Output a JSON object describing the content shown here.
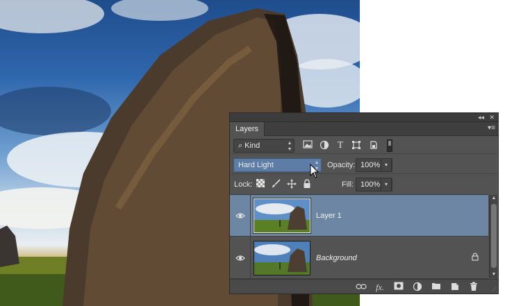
{
  "panel": {
    "tab_label": "Layers",
    "collapse_glyph": "◂◂",
    "close_glyph": "✕",
    "menu_glyph": "▾≡"
  },
  "filter": {
    "kind_label": "Kind",
    "kind_glyph": "⌕",
    "type_filter_glyph": "T"
  },
  "blend": {
    "mode": "Hard Light",
    "opacity_label": "Opacity:",
    "opacity_value": "100%",
    "fill_label": "Fill:",
    "fill_value": "100%"
  },
  "lock": {
    "label": "Lock:"
  },
  "layers": [
    {
      "name": "Layer 1",
      "selected": true,
      "locked": false
    },
    {
      "name": "Background",
      "selected": false,
      "locked": true
    }
  ],
  "bottom_bar": {
    "fx_label": "fx."
  },
  "colors": {
    "panel_bg": "#535353",
    "selection": "#6d86a3",
    "blend_highlight": "#5d7ca6"
  }
}
